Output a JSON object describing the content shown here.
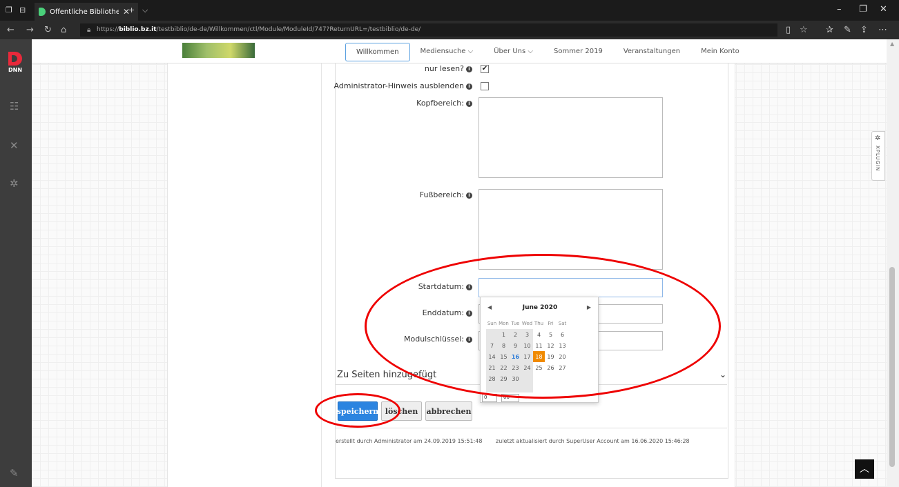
{
  "browser": {
    "tab_title": "Öffentliche Bibliothek N",
    "url_prefix": "https://",
    "url_host": "biblio.bz.it",
    "url_path": "/testbiblio/de-de/Willkommen/ctl/Module/ModuleId/747?ReturnURL=/testbiblio/de-de/"
  },
  "sidebar": {
    "logo_text": "DNN"
  },
  "nav": {
    "items": [
      "Willkommen",
      "Mediensuche ⌵",
      "Über Uns ⌵",
      "Sommer 2019",
      "Veranstaltungen",
      "Mein Konto"
    ]
  },
  "form": {
    "readonly_label": "nur lesen?",
    "hide_admin_label": "Administrator-Hinweis ausblenden",
    "header_label": "Kopfbereich:",
    "footer_label": "Fußbereich:",
    "start_label": "Startdatum:",
    "end_label": "Enddatum:",
    "module_key_label": "Modulschlüssel:",
    "readonly_checked": true,
    "hide_admin_checked": false
  },
  "datepicker": {
    "month_label": "June 2020",
    "weekdays": [
      "Sun",
      "Mon",
      "Tue",
      "Wed",
      "Thu",
      "Fri",
      "Sat"
    ],
    "weeks": [
      [
        "",
        "1",
        "2",
        "3",
        "4",
        "5",
        "6"
      ],
      [
        "7",
        "8",
        "9",
        "10",
        "11",
        "12",
        "13"
      ],
      [
        "14",
        "15",
        "16",
        "17",
        "18",
        "19",
        "20"
      ],
      [
        "21",
        "22",
        "23",
        "24",
        "25",
        "26",
        "27"
      ],
      [
        "28",
        "29",
        "30",
        "",
        "",
        "",
        ""
      ]
    ],
    "today": "16",
    "selected": "18",
    "hour": "0",
    "minute": "00"
  },
  "section": {
    "added_to_pages": "Zu Seiten hinzugefügt"
  },
  "buttons": {
    "save": "speichern",
    "delete": "löschen",
    "cancel": "abbrechen"
  },
  "meta": {
    "created": "erstellt durch Administrator am 24.09.2019 15:51:48",
    "updated": "zuletzt aktualisiert durch SuperUser Account am 16.06.2020 15:46:28"
  },
  "xplugin": {
    "label": "XPLUGIN"
  },
  "colors": {
    "primary_button": "#2b84e0",
    "selected_day": "#f08a00",
    "annotation": "#e00000"
  }
}
